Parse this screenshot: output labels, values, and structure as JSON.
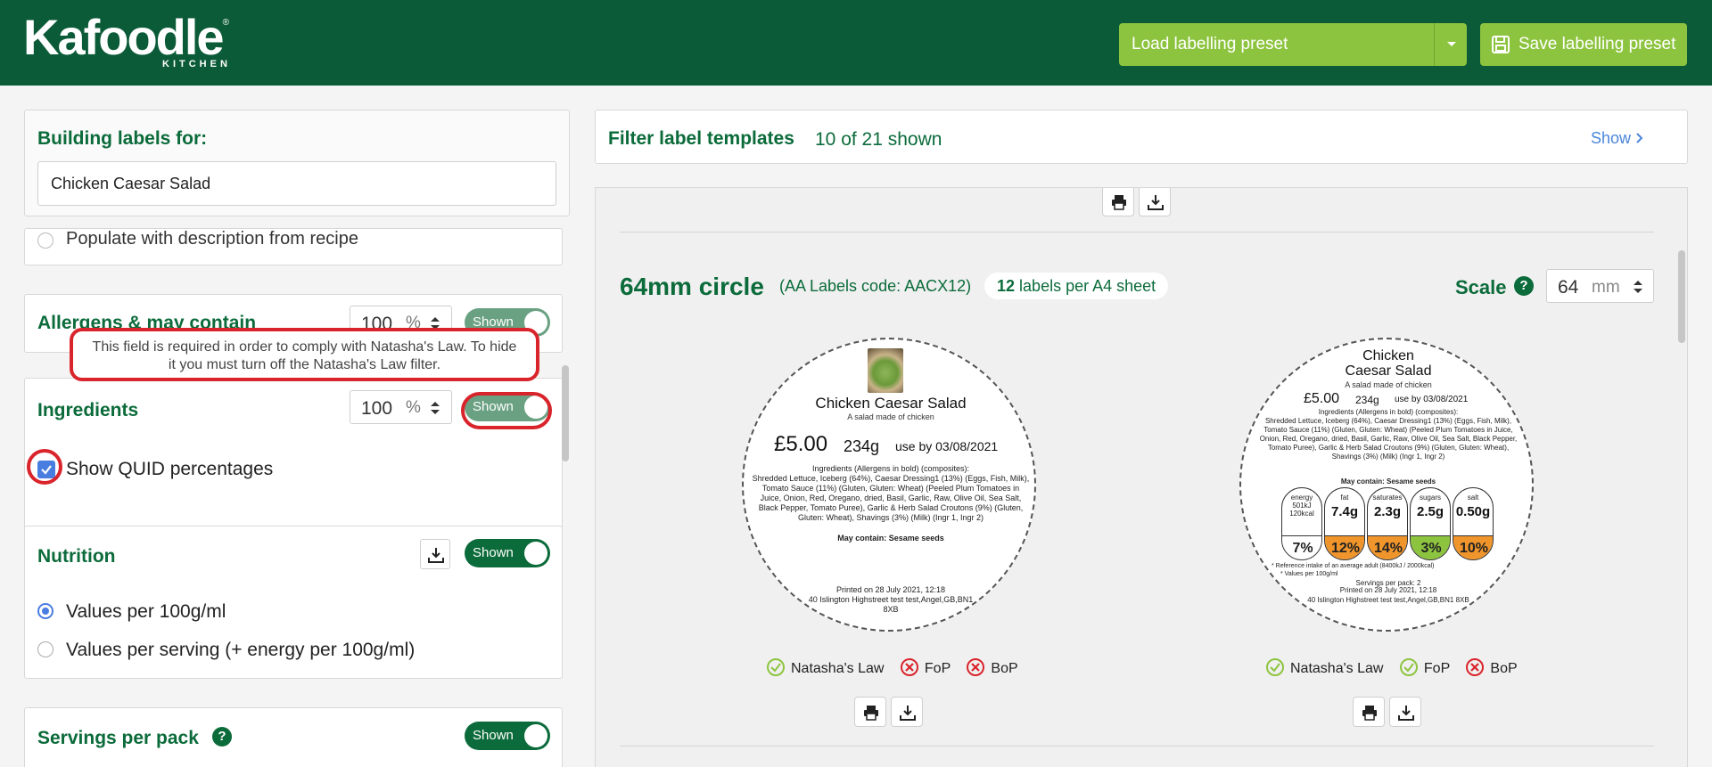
{
  "header": {
    "logo_text": "Kafoodle",
    "logo_sub": "KITCHEN",
    "logo_reg": "®",
    "load_preset_label": "Load labelling preset",
    "save_preset_label": "Save labelling preset"
  },
  "building": {
    "title": "Building labels for:",
    "recipe": "Chicken Caesar Salad"
  },
  "description_option": "Populate with description from recipe",
  "allergens": {
    "title": "Allergens & may contain",
    "percent": "100",
    "unit": "%",
    "toggle": "Shown"
  },
  "tooltip": "This field is required in order to comply with Natasha's Law. To hide it you must turn off the Natasha's Law filter.",
  "ingredients": {
    "title": "Ingredients",
    "percent": "100",
    "unit": "%",
    "toggle": "Shown",
    "quid_label": "Show QUID percentages"
  },
  "nutrition": {
    "title": "Nutrition",
    "toggle": "Shown",
    "option1": "Values per 100g/ml",
    "option2": "Values per serving (+ energy per 100g/ml)"
  },
  "servings": {
    "title": "Servings per pack",
    "toggle": "Shown",
    "help": "?"
  },
  "filter": {
    "title": "Filter label templates",
    "count": "10 of 21 shown",
    "show": "Show"
  },
  "template": {
    "title": "64mm circle",
    "code": "(AA Labels code: AACX12)",
    "per_sheet_count": "12",
    "per_sheet_text": "labels per A4 sheet",
    "scale_label": "Scale",
    "scale_value": "64",
    "scale_unit": "mm"
  },
  "label1": {
    "name": "Chicken Caesar Salad",
    "desc": "A salad made of chicken",
    "price": "£5.00",
    "weight": "234g",
    "useby": "use by 03/08/2021",
    "ingredients_heading": "Ingredients (Allergens in bold) (composites):",
    "ingredients_text": "Shredded Lettuce, Iceberg (64%), Caesar Dressing1 (13%) (Eggs, Fish, Milk), Tomato Sauce (11%) (Gluten, Gluten: Wheat) (Peeled Plum Tomatoes in Juice, Onion, Red, Oregano, dried, Basil, Garlic, Raw, Olive Oil, Sea Salt, Black Pepper, Tomato Puree), Garlic & Herb Salad Croutons (9%) (Gluten, Gluten: Wheat), Shavings (3%) (Milk) (Ingr 1, Ingr 2)",
    "may_contain": "May contain: Sesame seeds",
    "printed": "Printed on 28 July 2021, 12:18",
    "address": "40 Islington Highstreet test test,Angel,GB,BN1 8XB",
    "badges": [
      "Natasha's Law",
      "FoP",
      "BoP"
    ]
  },
  "label2": {
    "name_line1": "Chicken",
    "name_line2": "Caesar Salad",
    "desc": "A salad made of chicken",
    "price": "£5.00",
    "weight": "234g",
    "useby": "use by 03/08/2021",
    "ingredients_heading": "Ingredients (Allergens in bold) (composites):",
    "ingredients_text": "Shredded Lettuce, Iceberg (64%), Caesar Dressing1 (13%) (Eggs, Fish, Milk), Tomato Sauce (11%) (Gluten, Gluten: Wheat) (Peeled Plum Tomatoes in Juice, Onion, Red, Oregano, dried, Basil, Garlic, Raw, Olive Oil, Sea Salt, Black Pepper, Tomato Puree), Garlic & Herb Salad Croutons (9%) (Gluten, Gluten: Wheat), Shavings (3%) (Milk) (Ingr 1, Ingr 2)",
    "may_contain": "May contain: Sesame seeds",
    "gda": [
      {
        "top": "energy 501kJ 120kcal",
        "value": "",
        "pct": "7%",
        "color": "#ffffff"
      },
      {
        "top": "fat",
        "value": "7.4g",
        "pct": "12%",
        "color": "#f0952b"
      },
      {
        "top": "saturates",
        "value": "2.3g",
        "pct": "14%",
        "color": "#f0952b"
      },
      {
        "top": "sugars",
        "value": "2.5g",
        "pct": "3%",
        "color": "#8dc43f"
      },
      {
        "top": "salt",
        "value": "0.50g",
        "pct": "10%",
        "color": "#f0952b"
      }
    ],
    "ri_note": "* Reference intake of an average adult (8400kJ / 2000kcal)",
    "values_note": "* Values per 100g/ml",
    "servings_note": "Servings per pack: 2",
    "printed": "Printed on 28 July 2021, 12:18",
    "address": "40 Islington Highstreet test test,Angel,GB,BN1 8XB",
    "badges": [
      "Natasha's Law",
      "FoP",
      "BoP"
    ]
  },
  "colors": {
    "brand_green": "#0b5b38",
    "accent_green": "#8dc43f",
    "alert_red": "#d9242b",
    "link_blue": "#4a86d9"
  }
}
